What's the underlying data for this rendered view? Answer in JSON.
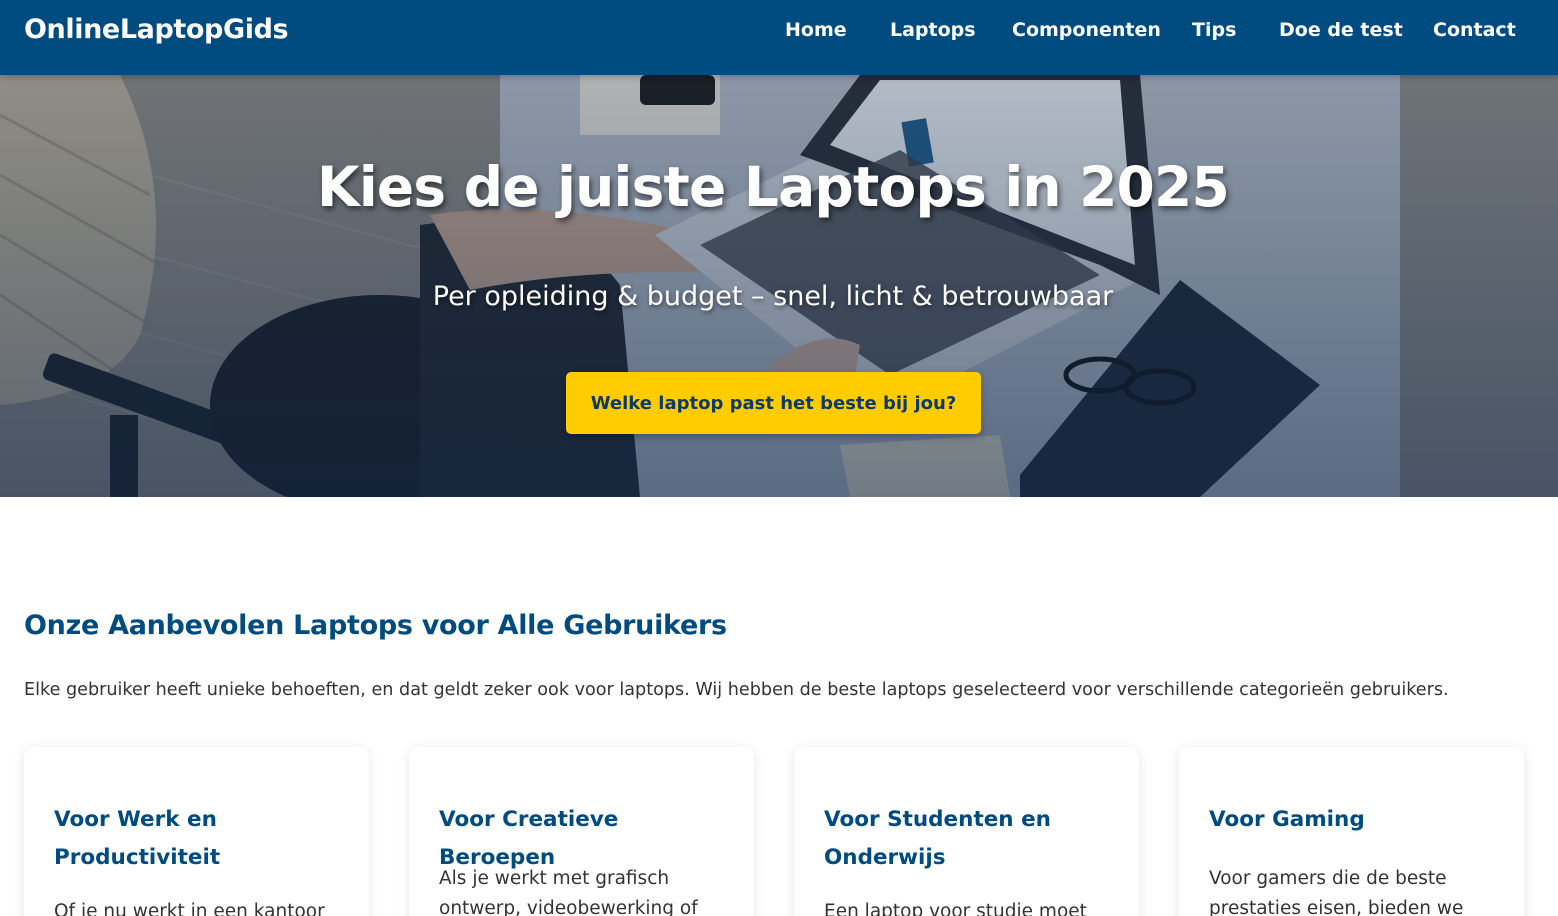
{
  "brand": {
    "name": "OnlineLaptopGids",
    "primary_color": "#004b80",
    "accent_color": "#ffcc00"
  },
  "nav": {
    "items": [
      {
        "label": "Home"
      },
      {
        "label": "Laptops"
      },
      {
        "label": "Componenten"
      },
      {
        "label": "Tips"
      },
      {
        "label": "Doe de test"
      },
      {
        "label": "Contact"
      }
    ]
  },
  "hero": {
    "title": "Kies de juiste Laptops in 2025",
    "subtitle": "Per opleiding & budget – snel, licht & betrouwbaar",
    "cta_label": "Welke laptop past het beste bij jou?"
  },
  "section": {
    "title": "Onze Aanbevolen Laptops voor Alle Gebruikers",
    "intro": "Elke gebruiker heeft unieke behoeften, en dat geldt zeker ook voor laptops. Wij hebben de beste laptops geselecteerd voor verschillende categorieën gebruikers."
  },
  "cards": [
    {
      "title": "Voor Werk en Productiviteit",
      "text": "Of je nu werkt in een kantoor"
    },
    {
      "title": "Voor Creatieve Beroepen",
      "text": "Als je werkt met grafisch ontwerp, videobewerking of"
    },
    {
      "title": "Voor Studenten en Onderwijs",
      "text": "Een laptop voor studie moet"
    },
    {
      "title": "Voor Gaming",
      "text": "Voor gamers die de beste prestaties eisen, bieden we"
    }
  ]
}
